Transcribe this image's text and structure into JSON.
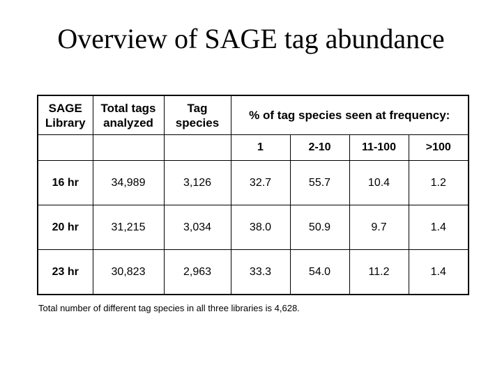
{
  "title": "Overview of SAGE tag abundance",
  "table": {
    "headers": {
      "library": "SAGE Library",
      "library_line1": "SAGE",
      "library_line2": "Library",
      "total_line1": "Total tags",
      "total_line2": "analyzed",
      "species_line1": "Tag",
      "species_line2": "species",
      "frequency": "% of tag species seen at frequency:"
    },
    "frequency_bins": [
      "1",
      "2-10",
      "11-100",
      ">100"
    ],
    "rows": [
      {
        "library": "16 hr",
        "total_tags": "34,989",
        "tag_species": "3,126",
        "freq": [
          "32.7",
          "55.7",
          "10.4",
          "1.2"
        ]
      },
      {
        "library": "20 hr",
        "total_tags": "31,215",
        "tag_species": "3,034",
        "freq": [
          "38.0",
          "50.9",
          "9.7",
          "1.4"
        ]
      },
      {
        "library": "23 hr",
        "total_tags": "30,823",
        "tag_species": "2,963",
        "freq": [
          "33.3",
          "54.0",
          "11.2",
          "1.4"
        ]
      }
    ]
  },
  "footnote": "Total number of different tag species in all three libraries is 4,628."
}
